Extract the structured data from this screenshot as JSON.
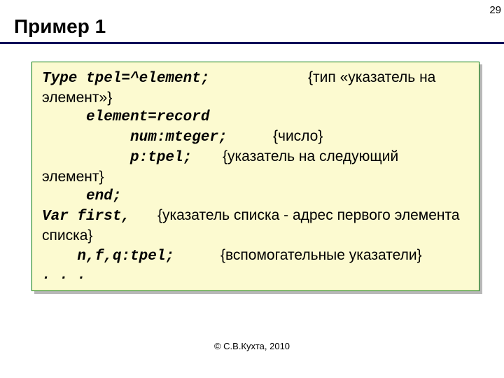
{
  "pageNumber": "29",
  "title": "Пример 1",
  "code": {
    "l1a": "Type tpel=^element;",
    "l1b": "{тип «указатель на",
    "l2": "элемент»}",
    "l3": "     element=record",
    "l4a": "          num:mteger;",
    "l4b": "{число}",
    "l5a": "          p:tpel;",
    "l5b": "{указатель на следующий",
    "l6": "элемент}",
    "l7": "     end;",
    "l8a": "Var first,",
    "l8b": "{указатель списка - адрес первого элемента",
    "l9": "списка}",
    "l10a": "    n,f,q:tpel;",
    "l10b": "{вспомогательные указатели}",
    "l11": ". . ."
  },
  "footer": "© С.В.Кухта, 2010"
}
